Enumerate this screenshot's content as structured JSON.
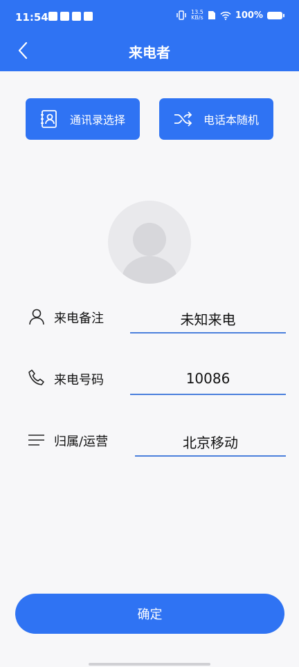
{
  "status_bar": {
    "time": "11:54",
    "net_speed_value": "13.5",
    "net_speed_unit": "KB/s",
    "battery_percent": "100%"
  },
  "nav": {
    "title": "来电者",
    "back_icon": "chevron-left-icon"
  },
  "actions": {
    "contacts_label": "通讯录选择",
    "contacts_icon": "contact-book-icon",
    "random_label": "电话本随机",
    "random_icon": "shuffle-icon"
  },
  "form": {
    "note_label": "来电备注",
    "note_value": "未知来电",
    "number_label": "来电号码",
    "number_value": "10086",
    "location_label": "归属/运营",
    "location_value": "北京移动"
  },
  "confirm_label": "确定",
  "colors": {
    "primary": "#2f73f3",
    "background": "#f7f7f9",
    "avatar_bg": "#e9e9ec",
    "underline": "#4a7fdc"
  }
}
